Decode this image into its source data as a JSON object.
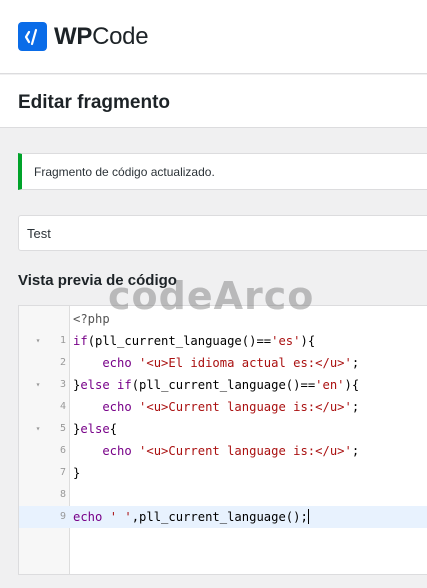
{
  "app": {
    "logo_text_bold": "WP",
    "logo_text_light": "Code",
    "logo_icon": "code-slash-icon"
  },
  "header": {
    "title": "Editar fragmento"
  },
  "notice": {
    "text": "Fragmento de código actualizado.",
    "accent_color": "#00a32a"
  },
  "snippet": {
    "title_value": "Test"
  },
  "preview": {
    "label": "Vista previa de código"
  },
  "watermark": {
    "text": "codeArco"
  },
  "code": {
    "lines": [
      {
        "num": "",
        "fold": "",
        "segments": [
          {
            "t": "<?php",
            "c": "c-meta"
          }
        ]
      },
      {
        "num": "1",
        "fold": "▾",
        "segments": [
          {
            "t": "if",
            "c": "c-kw"
          },
          {
            "t": "(pll_current_language()==",
            "c": "c-fn"
          },
          {
            "t": "'es'",
            "c": "c-str"
          },
          {
            "t": "){",
            "c": "c-fn"
          }
        ]
      },
      {
        "num": "2",
        "fold": "",
        "segments": [
          {
            "t": "    echo ",
            "c": "c-kw"
          },
          {
            "t": "'<u>El idioma actual es:</u>'",
            "c": "c-str"
          },
          {
            "t": ";",
            "c": "c-fn"
          }
        ]
      },
      {
        "num": "3",
        "fold": "▾",
        "segments": [
          {
            "t": "}",
            "c": "c-fn"
          },
          {
            "t": "else if",
            "c": "c-kw"
          },
          {
            "t": "(pll_current_language()==",
            "c": "c-fn"
          },
          {
            "t": "'en'",
            "c": "c-str"
          },
          {
            "t": "){",
            "c": "c-fn"
          }
        ]
      },
      {
        "num": "4",
        "fold": "",
        "segments": [
          {
            "t": "    echo ",
            "c": "c-kw"
          },
          {
            "t": "'<u>Current language is:</u>'",
            "c": "c-str"
          },
          {
            "t": ";",
            "c": "c-fn"
          }
        ]
      },
      {
        "num": "5",
        "fold": "▾",
        "segments": [
          {
            "t": "}",
            "c": "c-fn"
          },
          {
            "t": "else",
            "c": "c-kw"
          },
          {
            "t": "{",
            "c": "c-fn"
          }
        ]
      },
      {
        "num": "6",
        "fold": "",
        "segments": [
          {
            "t": "    echo ",
            "c": "c-kw"
          },
          {
            "t": "'<u>Current language is:</u>'",
            "c": "c-str"
          },
          {
            "t": ";",
            "c": "c-fn"
          }
        ]
      },
      {
        "num": "7",
        "fold": "",
        "segments": [
          {
            "t": "}",
            "c": "c-fn"
          }
        ]
      },
      {
        "num": "8",
        "fold": "",
        "segments": []
      },
      {
        "num": "9",
        "fold": "",
        "active": true,
        "cursor": true,
        "segments": [
          {
            "t": "echo ",
            "c": "c-kw"
          },
          {
            "t": "' '",
            "c": "c-str"
          },
          {
            "t": ",pll_current_language();",
            "c": "c-fn"
          }
        ]
      }
    ]
  }
}
